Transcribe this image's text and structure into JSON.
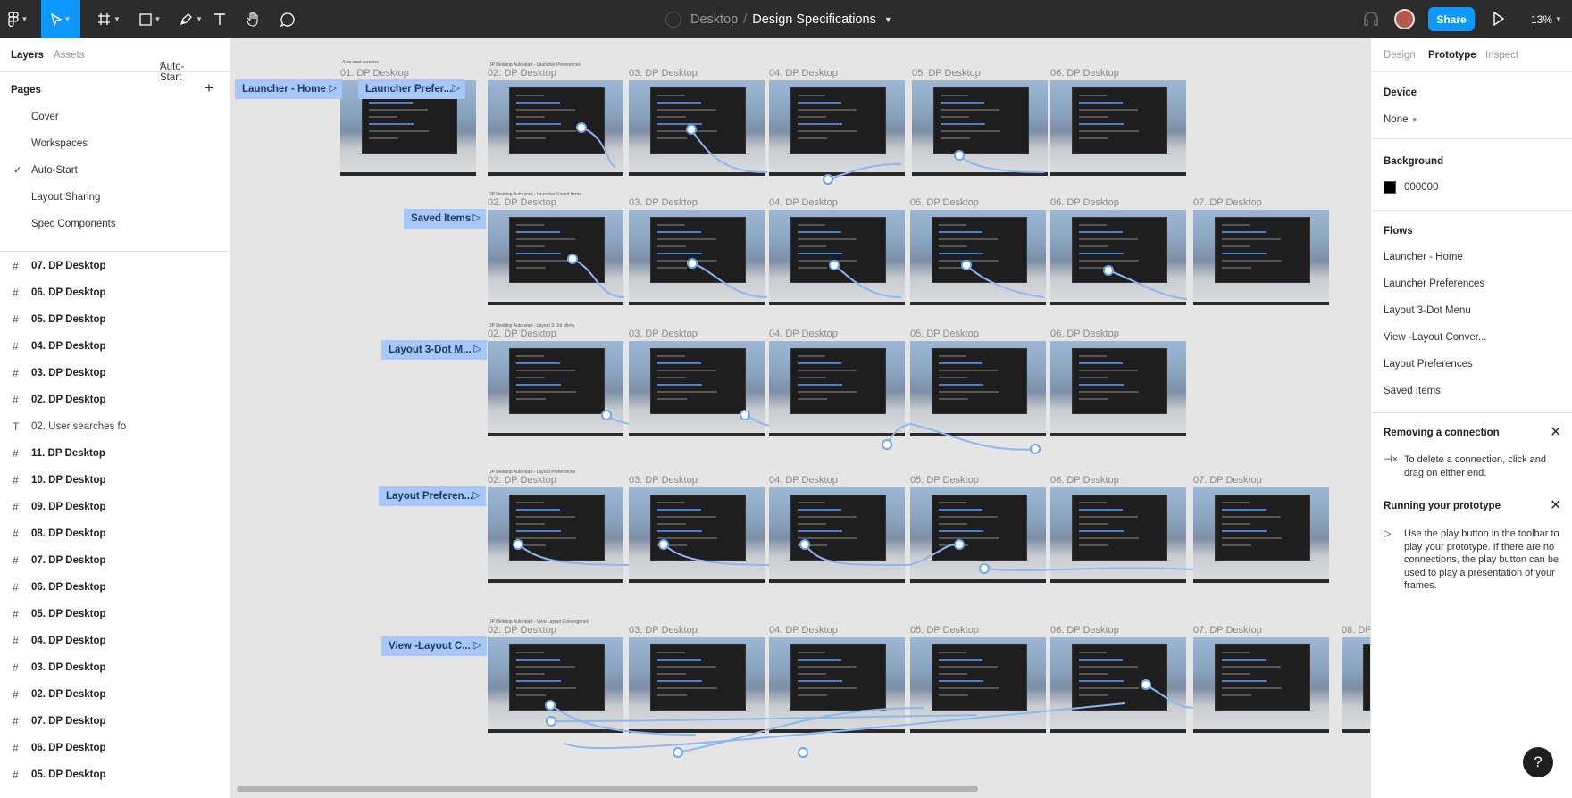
{
  "toolbar": {
    "project": "Desktop",
    "separator": "/",
    "file_name": "Design Specifications",
    "share_label": "Share",
    "zoom": "13%"
  },
  "left_panel": {
    "tabs": [
      "Layers",
      "Assets"
    ],
    "page_selector": "Auto-Start",
    "pages_heading": "Pages",
    "pages": [
      "Cover",
      "Workspaces",
      "Auto-Start",
      "Layout Sharing",
      "Spec Components"
    ],
    "active_page": "Auto-Start",
    "layers": [
      "07. DP Desktop",
      "06. DP Desktop",
      "05. DP Desktop",
      "04. DP Desktop",
      "03. DP Desktop",
      "02. DP Desktop",
      "02. User searches fo",
      "11. DP Desktop",
      "10. DP Desktop",
      "09. DP Desktop",
      "08. DP Desktop",
      "07. DP Desktop",
      "06. DP Desktop",
      "05. DP Desktop",
      "04. DP Desktop",
      "03. DP Desktop",
      "02. DP Desktop",
      "07. DP Desktop",
      "06. DP Desktop",
      "05. DP Desktop"
    ]
  },
  "canvas": {
    "section_title": "Auto-start screens",
    "flows": [
      {
        "tag": "Launcher - Home",
        "frames": [
          "01. DP Desktop"
        ]
      },
      {
        "tag": "Launcher Prefer...",
        "caption": "DP Desktop Auto-start - Launcher Preferences",
        "frames": [
          "02. DP Desktop",
          "03. DP Desktop",
          "04. DP Desktop",
          "05. DP Desktop",
          "06. DP Desktop"
        ]
      },
      {
        "tag": "Saved Items",
        "caption": "DP Desktop Auto-start - Launcher Saved Items",
        "frames": [
          "02. DP Desktop",
          "03. DP Desktop",
          "04. DP Desktop",
          "05. DP Desktop",
          "06. DP Desktop",
          "07. DP Desktop"
        ]
      },
      {
        "tag": "Layout 3-Dot M...",
        "caption": "DP Desktop Auto-start - Layout 3-Dot Menu",
        "frames": [
          "02. DP Desktop",
          "03. DP Desktop",
          "04. DP Desktop",
          "05. DP Desktop",
          "06. DP Desktop"
        ]
      },
      {
        "tag": "Layout Preferen...",
        "caption": "DP Desktop Auto-start - Layout Preferences",
        "frames": [
          "02. DP Desktop",
          "03. DP Desktop",
          "04. DP Desktop",
          "05. DP Desktop",
          "06. DP Desktop",
          "07. DP Desktop"
        ]
      },
      {
        "tag": "View -Layout C...",
        "caption": "DP Desktop Auto-start - View Layout Convergence",
        "frames": [
          "02. DP Desktop",
          "03. DP Desktop",
          "04. DP Desktop",
          "05. DP Desktop",
          "06. DP Desktop",
          "07. DP Desktop",
          "08. DP"
        ]
      }
    ]
  },
  "right_panel": {
    "tabs": [
      "Design",
      "Prototype",
      "Inspect"
    ],
    "active_tab": "Prototype",
    "device_heading": "Device",
    "device_value": "None",
    "background_heading": "Background",
    "background_value": "000000",
    "flows_heading": "Flows",
    "flows": [
      "Launcher - Home",
      "Launcher Preferences",
      "Layout 3-Dot Menu",
      "View -Layout Conver...",
      "Layout Preferences",
      "Saved Items"
    ],
    "tip1_title": "Removing a connection",
    "tip1_body": "To delete a connection, click and drag on either end.",
    "tip2_title": "Running your prototype",
    "tip2_body": "Use the play button in the toolbar to play your prototype. If there are no connections, the play button can be used to play a presentation of your frames."
  },
  "help_label": "?",
  "icons": [
    "figma-menu-icon",
    "move-tool-icon",
    "frame-tool-icon",
    "shape-tool-icon",
    "pen-tool-icon",
    "text-tool-icon",
    "hand-tool-icon",
    "comment-tool-icon",
    "headphones-icon",
    "play-icon"
  ]
}
